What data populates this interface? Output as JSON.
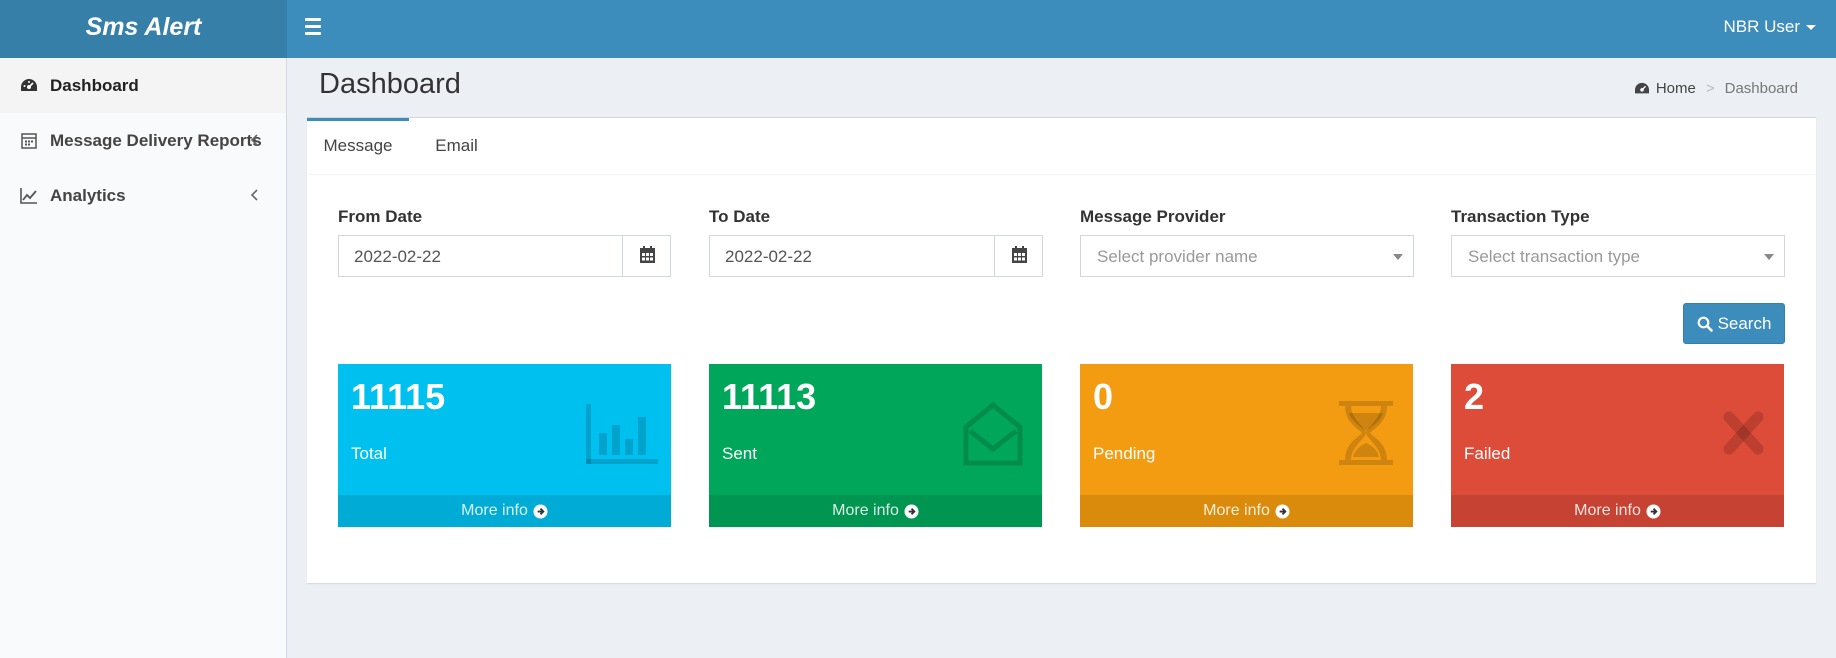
{
  "app": {
    "title": "Sms Alert",
    "user": "NBR User"
  },
  "sidebar": {
    "items": [
      {
        "label": "Dashboard",
        "icon": "dashboard-icon"
      },
      {
        "label": "Message Delivery Reports",
        "icon": "calendar-icon"
      },
      {
        "label": "Analytics",
        "icon": "line-chart-icon"
      }
    ]
  },
  "content": {
    "title": "Dashboard",
    "breadcrumb": {
      "home": "Home",
      "current": "Dashboard"
    }
  },
  "tabs": [
    {
      "label": "Message"
    },
    {
      "label": "Email"
    }
  ],
  "filters": {
    "from_date": {
      "label": "From Date",
      "value": "2022-02-22"
    },
    "to_date": {
      "label": "To Date",
      "value": "2022-02-22"
    },
    "provider": {
      "label": "Message Provider",
      "placeholder": "Select provider name"
    },
    "transaction": {
      "label": "Transaction Type",
      "placeholder": "Select transaction type"
    },
    "search_label": "Search"
  },
  "cards": [
    {
      "value": "11115",
      "label": "Total",
      "footer": "More info",
      "color": "#00c0ef",
      "footer_color": "#00acd6",
      "icon": "bar-chart-icon"
    },
    {
      "value": "11113",
      "label": "Sent",
      "footer": "More info",
      "color": "#00a65a",
      "footer_color": "#009551",
      "icon": "envelope-open-icon"
    },
    {
      "value": "0",
      "label": "Pending",
      "footer": "More info",
      "color": "#f39c12",
      "footer_color": "#db8b0b",
      "icon": "hourglass-icon"
    },
    {
      "value": "2",
      "label": "Failed",
      "footer": "More info",
      "color": "#dd4b39",
      "footer_color": "#c64333",
      "icon": "close-icon"
    }
  ]
}
